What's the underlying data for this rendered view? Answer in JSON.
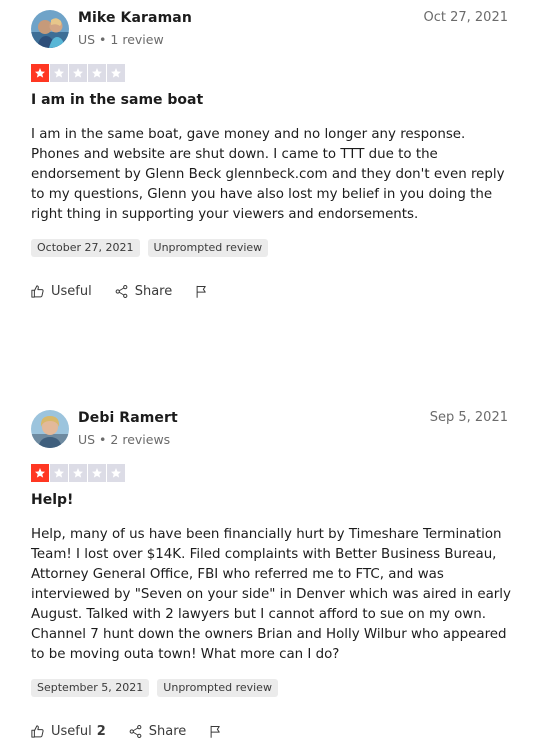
{
  "reviews": [
    {
      "author": "Mike Karaman",
      "meta": "US • 1 review",
      "date": "Oct 27, 2021",
      "rating": 1,
      "title": "I am in the same boat",
      "body": "I am in the same boat, gave money and no longer any response. Phones and website are shut down. I came to TTT due to the endorsement by Glenn Beck glennbeck.com and they don't even reply to my questions, Glenn you have also lost my belief in you doing the right thing in supporting your viewers and endorsements.",
      "experience_date": "October 27, 2021",
      "tag": "Unprompted review",
      "useful_label": "Useful",
      "useful_count": "",
      "share_label": "Share"
    },
    {
      "author": "Debi Ramert",
      "meta": "US • 2 reviews",
      "date": "Sep 5, 2021",
      "rating": 1,
      "title": "Help!",
      "body": "Help, many of us have been financially hurt by Timeshare Termination Team! I lost over $14K. Filed complaints with Better Business Bureau, Attorney General Office, FBI who referred me to FTC, and was interviewed by \"Seven on your side\" in Denver which was aired in early August. Talked with 2 lawyers but I cannot afford to sue on my own. Channel 7 hunt down the owners Brian and Holly Wilbur who appeared to be moving outa town! What more can I do?",
      "experience_date": "September 5, 2021",
      "tag": "Unprompted review",
      "useful_label": "Useful",
      "useful_count": "2",
      "share_label": "Share"
    }
  ],
  "icons": {
    "useful": "thumbs-up-icon",
    "share": "share-icon",
    "flag": "flag-icon",
    "star": "star-icon"
  },
  "colors": {
    "star_filled": "#ff3722",
    "star_empty": "#dcdce6",
    "tag_bg": "#ebebeb",
    "muted_text": "#6b6b6b"
  }
}
